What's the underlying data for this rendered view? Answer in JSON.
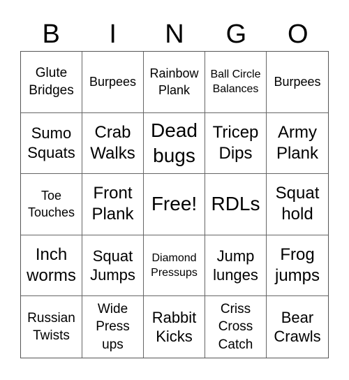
{
  "header": [
    "B",
    "I",
    "N",
    "G",
    "O"
  ],
  "cells": [
    {
      "text": "Glute Bridges",
      "size": "s19"
    },
    {
      "text": "Burpees",
      "size": "s18"
    },
    {
      "text": "Rainbow Plank",
      "size": "s18"
    },
    {
      "text": "Ball Circle Balances",
      "size": "s16"
    },
    {
      "text": "Burpees",
      "size": "s18"
    },
    {
      "text": "Sumo Squats",
      "size": "s22"
    },
    {
      "text": "Crab Walks",
      "size": "s24"
    },
    {
      "text": "Dead bugs",
      "size": "s28"
    },
    {
      "text": "Tricep Dips",
      "size": "s24"
    },
    {
      "text": "Army Plank",
      "size": "s24"
    },
    {
      "text": "Toe Touches",
      "size": "s18"
    },
    {
      "text": "Front Plank",
      "size": "s24"
    },
    {
      "text": "Free!",
      "size": "s28"
    },
    {
      "text": "RDLs",
      "size": "s28"
    },
    {
      "text": "Squat hold",
      "size": "s24"
    },
    {
      "text": "Inch worms",
      "size": "s24"
    },
    {
      "text": "Squat Jumps",
      "size": "s22"
    },
    {
      "text": "Diamond Pressups",
      "size": "s16"
    },
    {
      "text": "Jump lunges",
      "size": "s22"
    },
    {
      "text": "Frog jumps",
      "size": "s24"
    },
    {
      "text": "Russian Twists",
      "size": "s19"
    },
    {
      "text": "Wide Press ups",
      "size": "s19"
    },
    {
      "text": "Rabbit Kicks",
      "size": "s22"
    },
    {
      "text": "Criss Cross Catch",
      "size": "s19"
    },
    {
      "text": "Bear Crawls",
      "size": "s22"
    }
  ]
}
